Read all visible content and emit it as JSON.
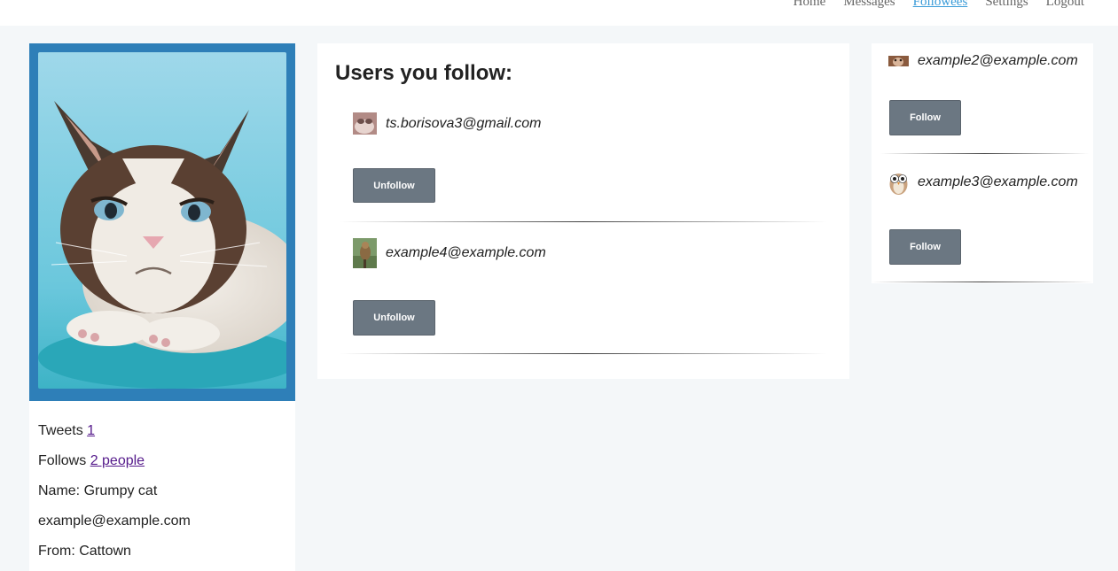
{
  "nav": {
    "items": [
      {
        "label": "Home",
        "active": false
      },
      {
        "label": "Messages",
        "active": false
      },
      {
        "label": "Followees",
        "active": true
      },
      {
        "label": "Settings",
        "active": false
      },
      {
        "label": "Logout",
        "active": false
      }
    ]
  },
  "profile": {
    "photo_icon": "grumpy-cat-photo",
    "tweets_label": "Tweets",
    "tweets_count": "1",
    "follows_label": "Follows",
    "follows_link": "2 people",
    "name": "Name: Grumpy cat",
    "email": "example@example.com",
    "from": "From: Cattown"
  },
  "main": {
    "title": "Users you follow:",
    "users": [
      {
        "email": "ts.borisova3@gmail.com",
        "avatar": "cat-avatar",
        "button": "Unfollow"
      },
      {
        "email": "example4@example.com",
        "avatar": "bird-avatar",
        "button": "Unfollow"
      }
    ]
  },
  "suggestions": {
    "users": [
      {
        "email": "example2@example.com",
        "avatar": "puppy-avatar",
        "button": "Follow"
      },
      {
        "email": "example3@example.com",
        "avatar": "owl-avatar",
        "button": "Follow"
      }
    ]
  },
  "colors": {
    "accent": "#2e7fb8",
    "button": "#6b7782",
    "link_active": "#3a9bd8",
    "link_visited": "#551a8b"
  }
}
